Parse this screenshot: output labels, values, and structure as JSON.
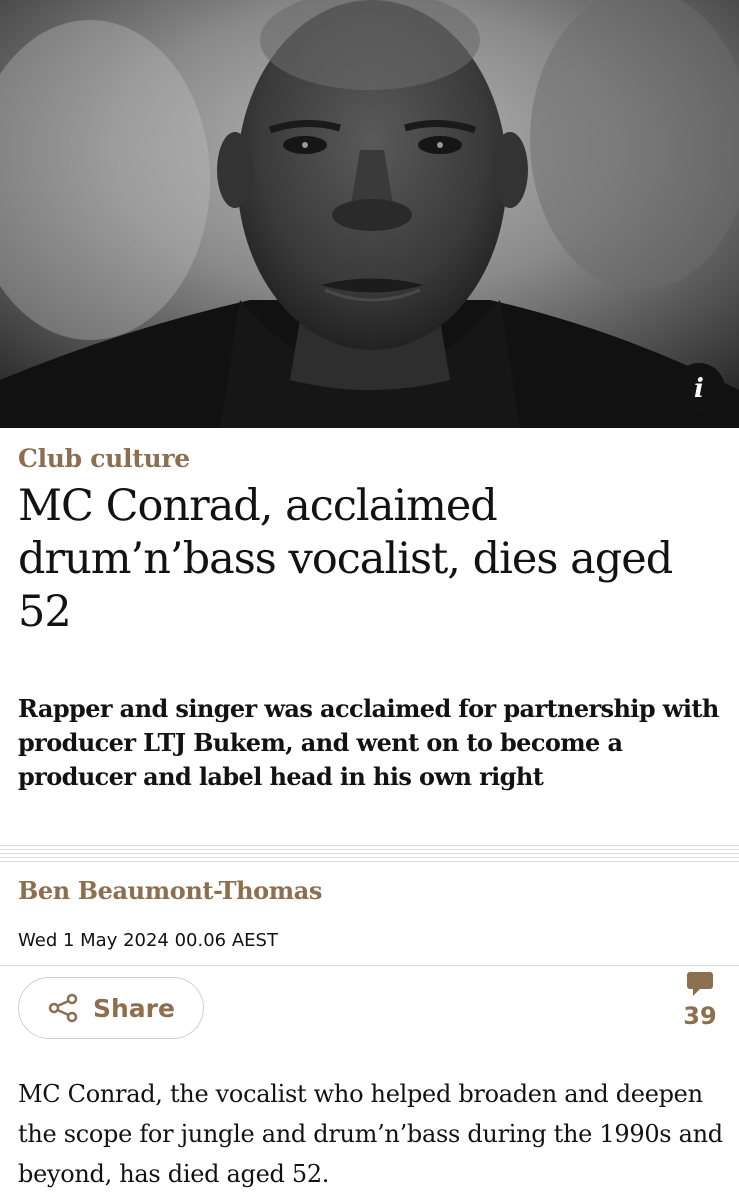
{
  "hero": {
    "info_label": "i"
  },
  "article": {
    "kicker": "Club culture",
    "headline": "MC Conrad, acclaimed drum’n’bass vocalist, dies aged 52",
    "standfirst": "Rapper and singer was acclaimed for partnership with producer LTJ Bukem, and went on to become a producer and label head in his own right",
    "byline": "Ben Beaumont-Thomas",
    "dateline": "Wed 1 May 2024 00.06 AEST",
    "body": "MC Conrad, the vocalist who helped broaden and deepen the scope for jungle and drum’n’bass during the 1990s and beyond, has died aged 52."
  },
  "actions": {
    "share_label": "Share",
    "comment_count": "39",
    "share_icon": "share-icon",
    "comment_icon": "comment-bubble-icon"
  },
  "colors": {
    "accent": "#8b6f4e",
    "text": "#121212",
    "rule": "#dcdcdc"
  }
}
